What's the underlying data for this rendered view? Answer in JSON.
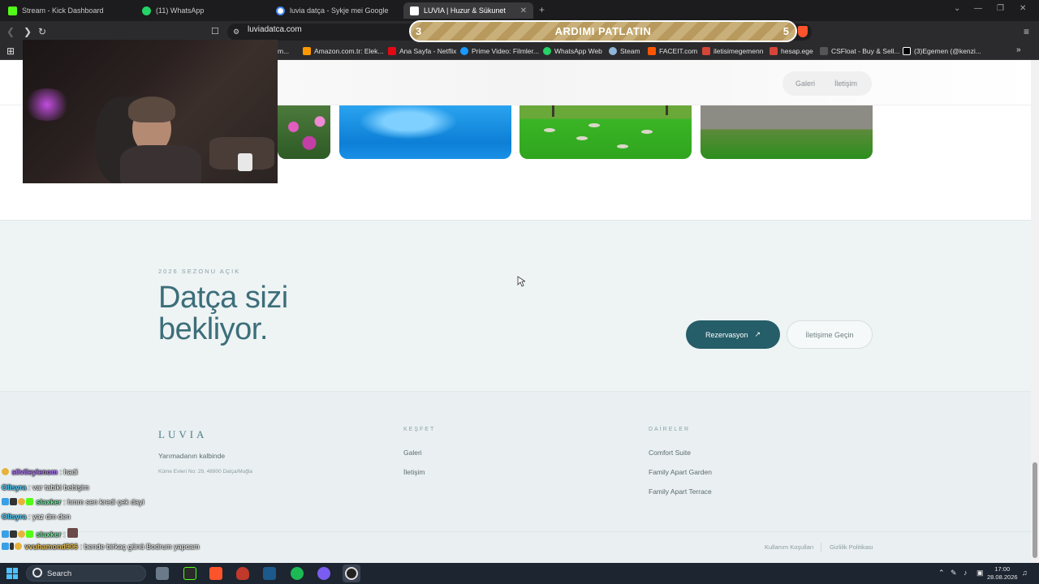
{
  "browser": {
    "tabs": [
      {
        "title": "Stream - Kick Dashboard",
        "icon": "kick-icon",
        "color": "#53fc18"
      },
      {
        "title": "(11) WhatsApp",
        "icon": "whatsapp-icon",
        "color": "#25d366"
      },
      {
        "title": "luvia datça - Sykje mei Google",
        "icon": "google-icon",
        "color": "#4285f4"
      },
      {
        "title": "LUVIA | Huzur & Sükunet",
        "icon": "site-icon",
        "color": "#ffffff",
        "active": true
      }
    ],
    "url": "luviadatca.com",
    "alert": {
      "left_count": "3",
      "text": "ARDIMI PATLATIN",
      "right_count": "5"
    },
    "bookmarks": [
      {
        "label": "m...",
        "color": "#888"
      },
      {
        "label": "Amazon.com.tr: Elek...",
        "color": "#ff9900"
      },
      {
        "label": "Ana Sayfa - Netflix",
        "color": "#e50914"
      },
      {
        "label": "Prime Video: Filmler...",
        "color": "#1a98ff"
      },
      {
        "label": "WhatsApp Web",
        "color": "#25d366"
      },
      {
        "label": "Steam",
        "color": "#1b2838"
      },
      {
        "label": "FACEIT.com",
        "color": "#ff5500"
      },
      {
        "label": "iletisimegemenn",
        "color": "#d44638"
      },
      {
        "label": "hesap.ege",
        "color": "#d44638"
      },
      {
        "label": "CSFloat - Buy & Sell...",
        "color": "#555"
      },
      {
        "label": "(3)Egemen (@kenzi...",
        "color": "#000"
      }
    ]
  },
  "site": {
    "nav": {
      "gallery": "Galeri",
      "contact": "İletişim"
    },
    "cta": {
      "eyebrow": "2026 SEZONU AÇIK",
      "headline_line1": "Datça sizi",
      "headline_line2": "bekliyor.",
      "reserve_label": "Rezervasyon",
      "reserve_icon": "↗",
      "contact_label": "İletişime Geçin"
    },
    "footer": {
      "logo": "LUVIA",
      "tagline": "Yarımadanın kalbinde",
      "address": "Küme Evleri No: 29, 48900 Datça/Muğla",
      "explore_heading": "KEŞFET",
      "explore_links": [
        "Galeri",
        "İletişim"
      ],
      "units_heading": "DAİRELER",
      "units_links": [
        "Comfort Suite",
        "Family Apart Garden",
        "Family Apart Terrace"
      ],
      "terms": "Kullanım Koşulları",
      "privacy": "Gizlilik Politikası"
    }
  },
  "chat": [
    {
      "user": "silvileylenom",
      "msg": ": hadi",
      "color": "#b57bff"
    },
    {
      "user": "Olisyra",
      "msg": ": var tabiki bebişim",
      "color": "#4fd1ff"
    },
    {
      "user": "slaxker",
      "msg": ": hmm sen kredi çek dayi",
      "color": "#6ef0a0"
    },
    {
      "user": "Olisyra",
      "msg": ": yaz dm den",
      "color": "#4fd1ff"
    },
    {
      "user": "slaxker",
      "msg": ":",
      "color": "#6ef0a0"
    },
    {
      "user": "vvuhamond906",
      "msg": ": bende birkaç günü Bodrum yapcam",
      "color": "#e7c15a"
    }
  ],
  "taskbar": {
    "search_label": "Search",
    "time": "17:00",
    "date": "28.08.2026"
  }
}
